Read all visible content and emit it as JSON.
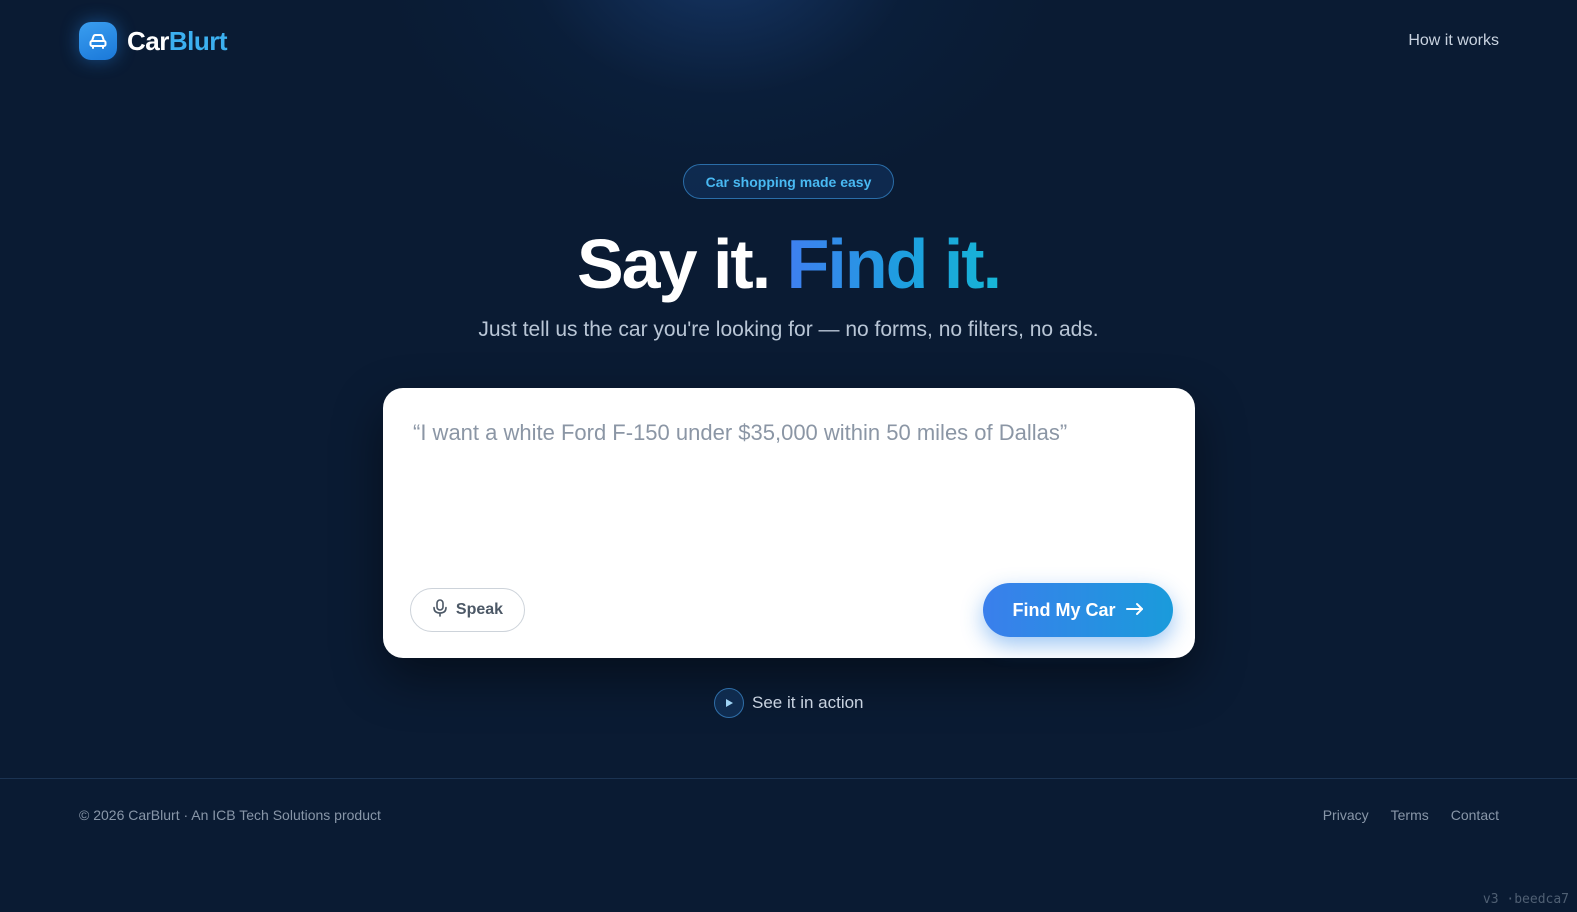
{
  "brand": {
    "name_part1": "Car",
    "name_part2": "Blurt",
    "icon": "car-icon"
  },
  "nav": {
    "how_it_works": "How it works"
  },
  "hero": {
    "pill": "Car shopping made easy",
    "headline_part1": "Say it.",
    "headline_part2": "Find it.",
    "subhead": "Just tell us the car you're looking for — no forms, no filters, no ads."
  },
  "search": {
    "placeholder": "“I want a white Ford F-150 under $35,000 within 50 miles of Dallas”",
    "value": "",
    "speak_label": "Speak",
    "speak_icon": "microphone-icon",
    "submit_label": "Find My Car",
    "submit_icon": "arrow-right-icon"
  },
  "demo": {
    "label": "See it in action",
    "icon": "play-icon"
  },
  "footer": {
    "copyright": "© 2026 CarBlurt · An ICB Tech Solutions product",
    "links": [
      "Privacy",
      "Terms",
      "Contact"
    ]
  },
  "version": "v3 ·beedca7",
  "colors": {
    "background": "#0a1b33",
    "accent": "#3cb0f0",
    "button_gradient_start": "#3a7fec",
    "button_gradient_end": "#1a9bdb"
  }
}
